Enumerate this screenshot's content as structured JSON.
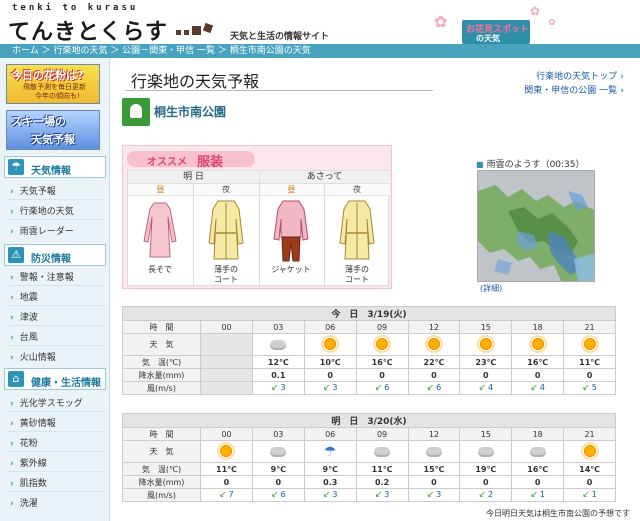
{
  "header": {
    "logo_roman": "tenki to kurasu",
    "logo_jp": "てんきとくらす",
    "tagline": "天気と生活の情報サイト",
    "hanami_line1": "お花見スポット",
    "hanami_line2": "の天気"
  },
  "breadcrumb": "ホーム ＞ 行楽地の天気 ＞ 公園－関東・甲信 一覧 ＞ 桐生市南公園の天気",
  "sidebar": {
    "pollen_title": "今日の花粉は?",
    "pollen_sub1": "飛散予測を毎日更新",
    "pollen_sub2": "今年の傾向も!",
    "ski_title1": "スキー場の",
    "ski_title2": "天気予報",
    "sections": [
      {
        "title": "天気情報",
        "icon": "umbrella-icon",
        "items": [
          "天気予報",
          "行楽地の天気",
          "雨雲レーダー"
        ]
      },
      {
        "title": "防災情報",
        "icon": "warning-icon",
        "items": [
          "警報・注意報",
          "地震",
          "津波",
          "台風",
          "火山情報"
        ]
      },
      {
        "title": "健康・生活情報",
        "icon": "house-icon",
        "items": [
          "光化学スモッグ",
          "黄砂情報",
          "花粉",
          "紫外線",
          "肌指数",
          "洗濯"
        ]
      }
    ]
  },
  "main": {
    "page_title": "行楽地の天気予報",
    "toplinks": [
      "行楽地の天気トップ",
      "関東・甲信の公園 一覧"
    ],
    "park_name": "桐生市南公園"
  },
  "clothes": {
    "head_a": "オススメ",
    "head_b": "服装",
    "days": [
      "明 日",
      "あさって"
    ],
    "tod": [
      "昼",
      "夜",
      "昼",
      "夜"
    ],
    "items": [
      "長そで",
      "薄手の\nコート",
      "ジャケット",
      "薄手の\nコート"
    ]
  },
  "radar": {
    "title": "雨雲のようす（00:35）",
    "more": "詳細"
  },
  "forecast": {
    "labels": {
      "time": "時　間",
      "weather": "天　気",
      "temp": "気　温(℃)",
      "precip": "降水量(mm)",
      "wind": "風(m/s)"
    },
    "days": [
      {
        "header": "今　日　3/19(火)",
        "hours": [
          "00",
          "03",
          "06",
          "09",
          "12",
          "15",
          "18",
          "21"
        ],
        "weather": [
          "",
          "cloud",
          "sun",
          "sun",
          "sun",
          "sun",
          "sun",
          "sun"
        ],
        "temps": [
          "",
          "12℃",
          "10℃",
          "16℃",
          "22℃",
          "23℃",
          "16℃",
          "11℃"
        ],
        "precip": [
          "",
          "0.1",
          "0",
          "0",
          "0",
          "0",
          "0",
          "0"
        ],
        "wind": [
          "",
          "3",
          "3",
          "6",
          "6",
          "4",
          "4",
          "5"
        ]
      },
      {
        "header": "明　日　3/20(水)",
        "hours": [
          "00",
          "03",
          "06",
          "09",
          "12",
          "15",
          "18",
          "21"
        ],
        "weather": [
          "sun",
          "cloud",
          "rain",
          "cloud",
          "cloud",
          "cloud",
          "cloud",
          "sun"
        ],
        "temps": [
          "11℃",
          "9℃",
          "9℃",
          "11℃",
          "15℃",
          "19℃",
          "16℃",
          "14℃"
        ],
        "precip": [
          "0",
          "0",
          "0.3",
          "0.2",
          "0",
          "0",
          "0",
          "0"
        ],
        "wind": [
          "7",
          "6",
          "3",
          "3",
          "3",
          "2",
          "1",
          "1"
        ]
      }
    ]
  },
  "footnote": "今日明日天気は桐生市南公園の予想です",
  "colors": {
    "accent": "#48a3bf",
    "pink": "#e0456d",
    "sidebar_bg": "#eaf4f8"
  }
}
